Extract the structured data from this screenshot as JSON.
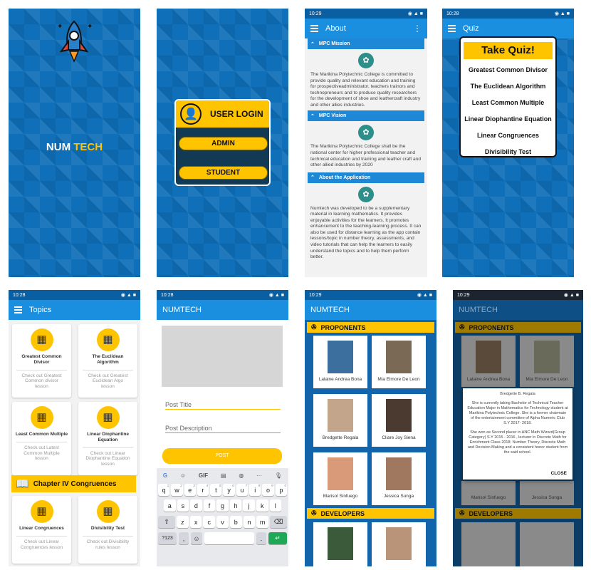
{
  "s1": {
    "logo_num": "NUM",
    "logo_tech": "TECH"
  },
  "s2": {
    "title": "USER LOGIN",
    "admin": "ADMIN",
    "student": "STUDENT"
  },
  "s3": {
    "time": "10:29",
    "title": "About",
    "mission": "MPC Mission",
    "mission_text": "The Marikina Polytechnic College is committed to provide quality and relevant education and training for prospectiveadministrator, teachers trainors and technopreneurs and to produce quality researchers for the development of shoe and leathercraft industry and other allies industries.",
    "vision": "MPC Vision",
    "vision_text": "The Marikina Polytechnic College shall be the national center for higher professional teacher and technical education and training and leather craft and other allied industries by 2020",
    "app": "About the Application",
    "app_text": "Numtech was developed to be a supplementary material in learning mathematics. It provides enjoyable activities for the learners. It promotes enhancement to the teaching-learning process. It can also be used for distance learning as the app contain lessons/topic in number theory, assessments, and video tutorials that can help the learners to easily understand the topics and to help them perform better."
  },
  "s4": {
    "time": "10:28",
    "title": "Quiz",
    "heading": "Take Quiz!",
    "items": [
      "Greatest Common Divisor",
      "The Euclidean Algorithm",
      "Least Common Multiple",
      "Linear Diophantine Equation",
      "Linear Congruences",
      "Divisibility Test"
    ]
  },
  "s5": {
    "time": "10:28",
    "title": "Topics",
    "cards": [
      {
        "title": "Greatest Common Divisor",
        "desc": "Check out Greatest Common divisor lesson"
      },
      {
        "title": "The Euclidean Algorithm",
        "desc": "Check out Greatest Euclidean Algo lesson"
      },
      {
        "title": "Least Common Multiple",
        "desc": "Check out Latest Common Multiple lesson"
      },
      {
        "title": "Linear Diophantine Equation",
        "desc": "Check out Linear Diophantine Equation lesson"
      },
      {
        "title": "Linear Congruences",
        "desc": "Check out Linear Congruences lesson"
      },
      {
        "title": "Divisibility Test",
        "desc": "Check out Divisibility rules lesson"
      }
    ],
    "chapter": "Chapter IV Congruences"
  },
  "s6": {
    "time": "10:28",
    "title": "NUMTECH",
    "post_title": "Post Title",
    "post_desc": "Post Description",
    "post": "POST",
    "gif": "GIF",
    "row1": [
      "q",
      "w",
      "e",
      "r",
      "t",
      "y",
      "u",
      "i",
      "o",
      "p"
    ],
    "row1_nums": [
      "1",
      "2",
      "3",
      "4",
      "5",
      "6",
      "7",
      "8",
      "9",
      "0"
    ],
    "row2": [
      "a",
      "s",
      "d",
      "f",
      "g",
      "h",
      "j",
      "k",
      "l"
    ],
    "row3": [
      "z",
      "x",
      "c",
      "v",
      "b",
      "n",
      "m"
    ],
    "sym": "?123",
    "comma": ",",
    "period": "."
  },
  "s7": {
    "time": "10:29",
    "title": "NUMTECH",
    "proponents": "PROPONENTS",
    "developers": "DEVELOPERS",
    "people": [
      "Lalaine Andrea Bona",
      "Mia Elmore De Leon",
      "Bredgette Regala",
      "Cliare Joy Siena",
      "Marisol Sinfuego",
      "Jessica Sunga"
    ]
  },
  "s8": {
    "time": "10:29",
    "title": "NUMTECH",
    "proponents": "PROPONENTS",
    "developers": "DEVELOPERS",
    "people": [
      "Lalaine Andrea Bona",
      "Mia Elmore De Leon",
      "Marisol Sinfuego",
      "Jessica Sunga"
    ],
    "dialog_name": "Bredgette B. Regala",
    "dialog_p1": "She is currently taking Bachelor of Technical Teacher Education Major in Mathematics for Technology student at Marikina Polytechnic College. She is a former chairmain of the entertainment committee of Alpha Numeric Club S.Y 2017- 2018.",
    "dialog_p2": "She won as Second placer in ANC Math Wizard(Group Category) S.Y 2015 - 2016 , lecturer in Discrete Math for Enrichment Class 2018: Number Theory, Discrete Math and Decision Making and a consistent honor student from the said school.",
    "close": "CLOSE"
  }
}
